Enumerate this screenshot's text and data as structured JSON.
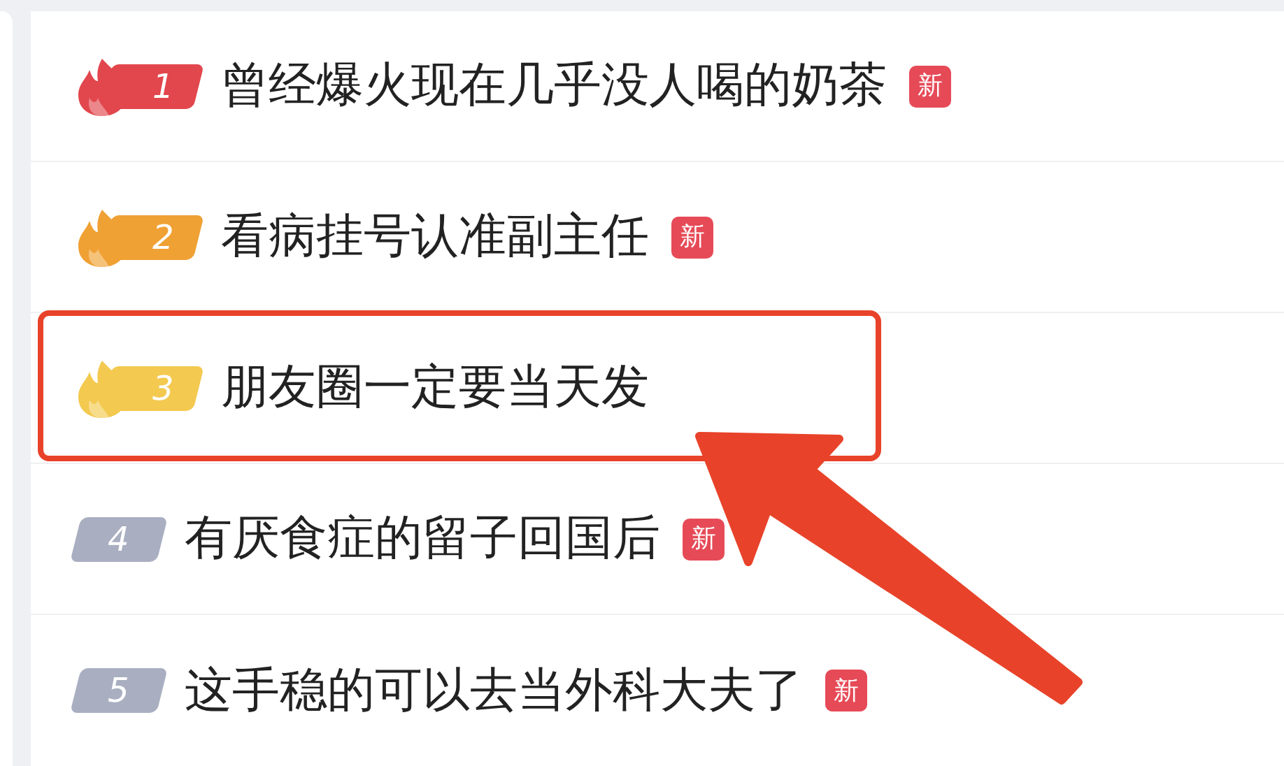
{
  "items": [
    {
      "rank": "1",
      "title": "曾经爆火现在几乎没人喝的奶茶",
      "kind": "hot",
      "color": "#e2474d",
      "new_badge": "新",
      "highlighted": false
    },
    {
      "rank": "2",
      "title": "看病挂号认准副主任",
      "kind": "hot",
      "color": "#f0a134",
      "new_badge": "新",
      "highlighted": false
    },
    {
      "rank": "3",
      "title": "朋友圈一定要当天发",
      "kind": "hot",
      "color": "#f3c94f",
      "highlighted": true
    },
    {
      "rank": "4",
      "title": "有厌食症的留子回国后",
      "kind": "plain",
      "color": "#a9afc1",
      "new_badge": "新",
      "highlighted": false
    },
    {
      "rank": "5",
      "title": "这手稳的可以去当外科大夫了",
      "kind": "plain",
      "color": "#a9afc1",
      "new_badge": "新",
      "highlighted": false
    }
  ]
}
